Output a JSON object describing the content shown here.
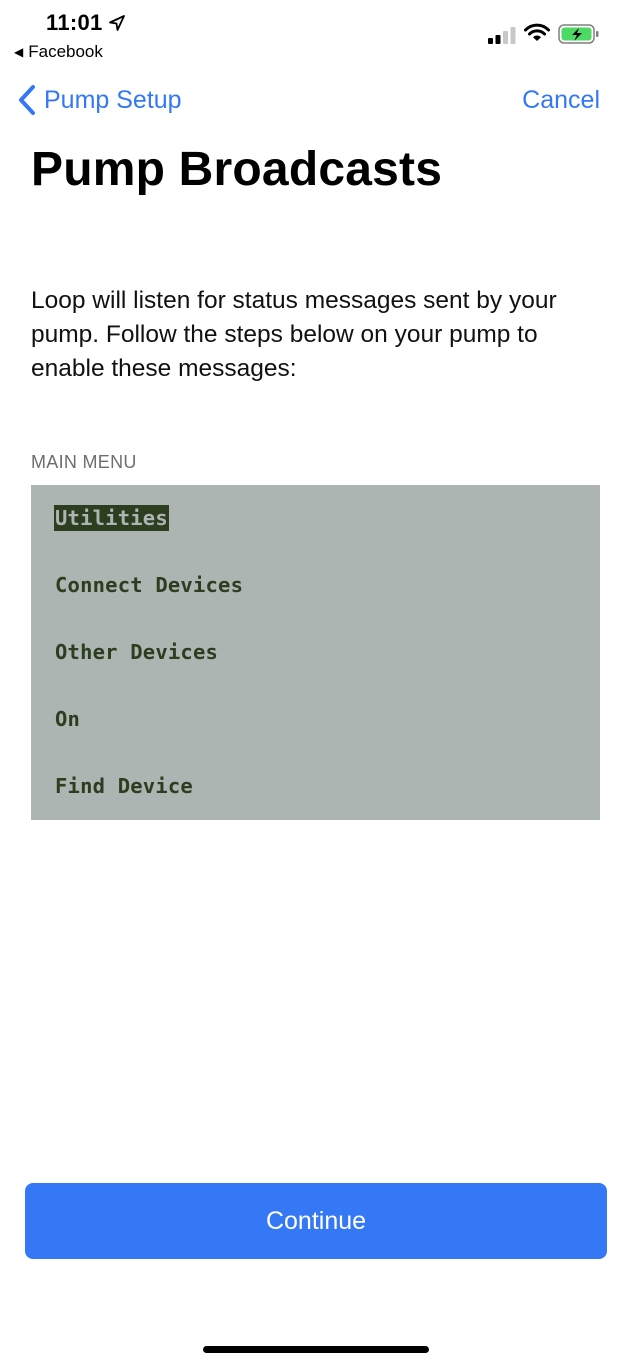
{
  "status_bar": {
    "time": "11:01",
    "back_app_label": "Facebook",
    "icons": [
      "location-arrow-icon",
      "cellular-signal-icon",
      "wifi-icon",
      "battery-charging-icon"
    ],
    "battery_color": "#4cd964"
  },
  "nav": {
    "back_label": "Pump Setup",
    "cancel_label": "Cancel"
  },
  "page": {
    "title": "Pump Broadcasts",
    "description": "Loop will listen for status messages sent by your pump. Follow the steps below on your pump to enable these messages:"
  },
  "menu": {
    "header": "MAIN MENU",
    "items": [
      {
        "label": "Utilities",
        "selected": true
      },
      {
        "label": "Connect Devices",
        "selected": false
      },
      {
        "label": "Other Devices",
        "selected": false
      },
      {
        "label": "On",
        "selected": false
      },
      {
        "label": "Find Device",
        "selected": false
      }
    ]
  },
  "footer": {
    "continue_label": "Continue"
  },
  "colors": {
    "accent": "#3478f6",
    "lcd_background": "#acb5b1",
    "lcd_text": "#2c3d20"
  }
}
